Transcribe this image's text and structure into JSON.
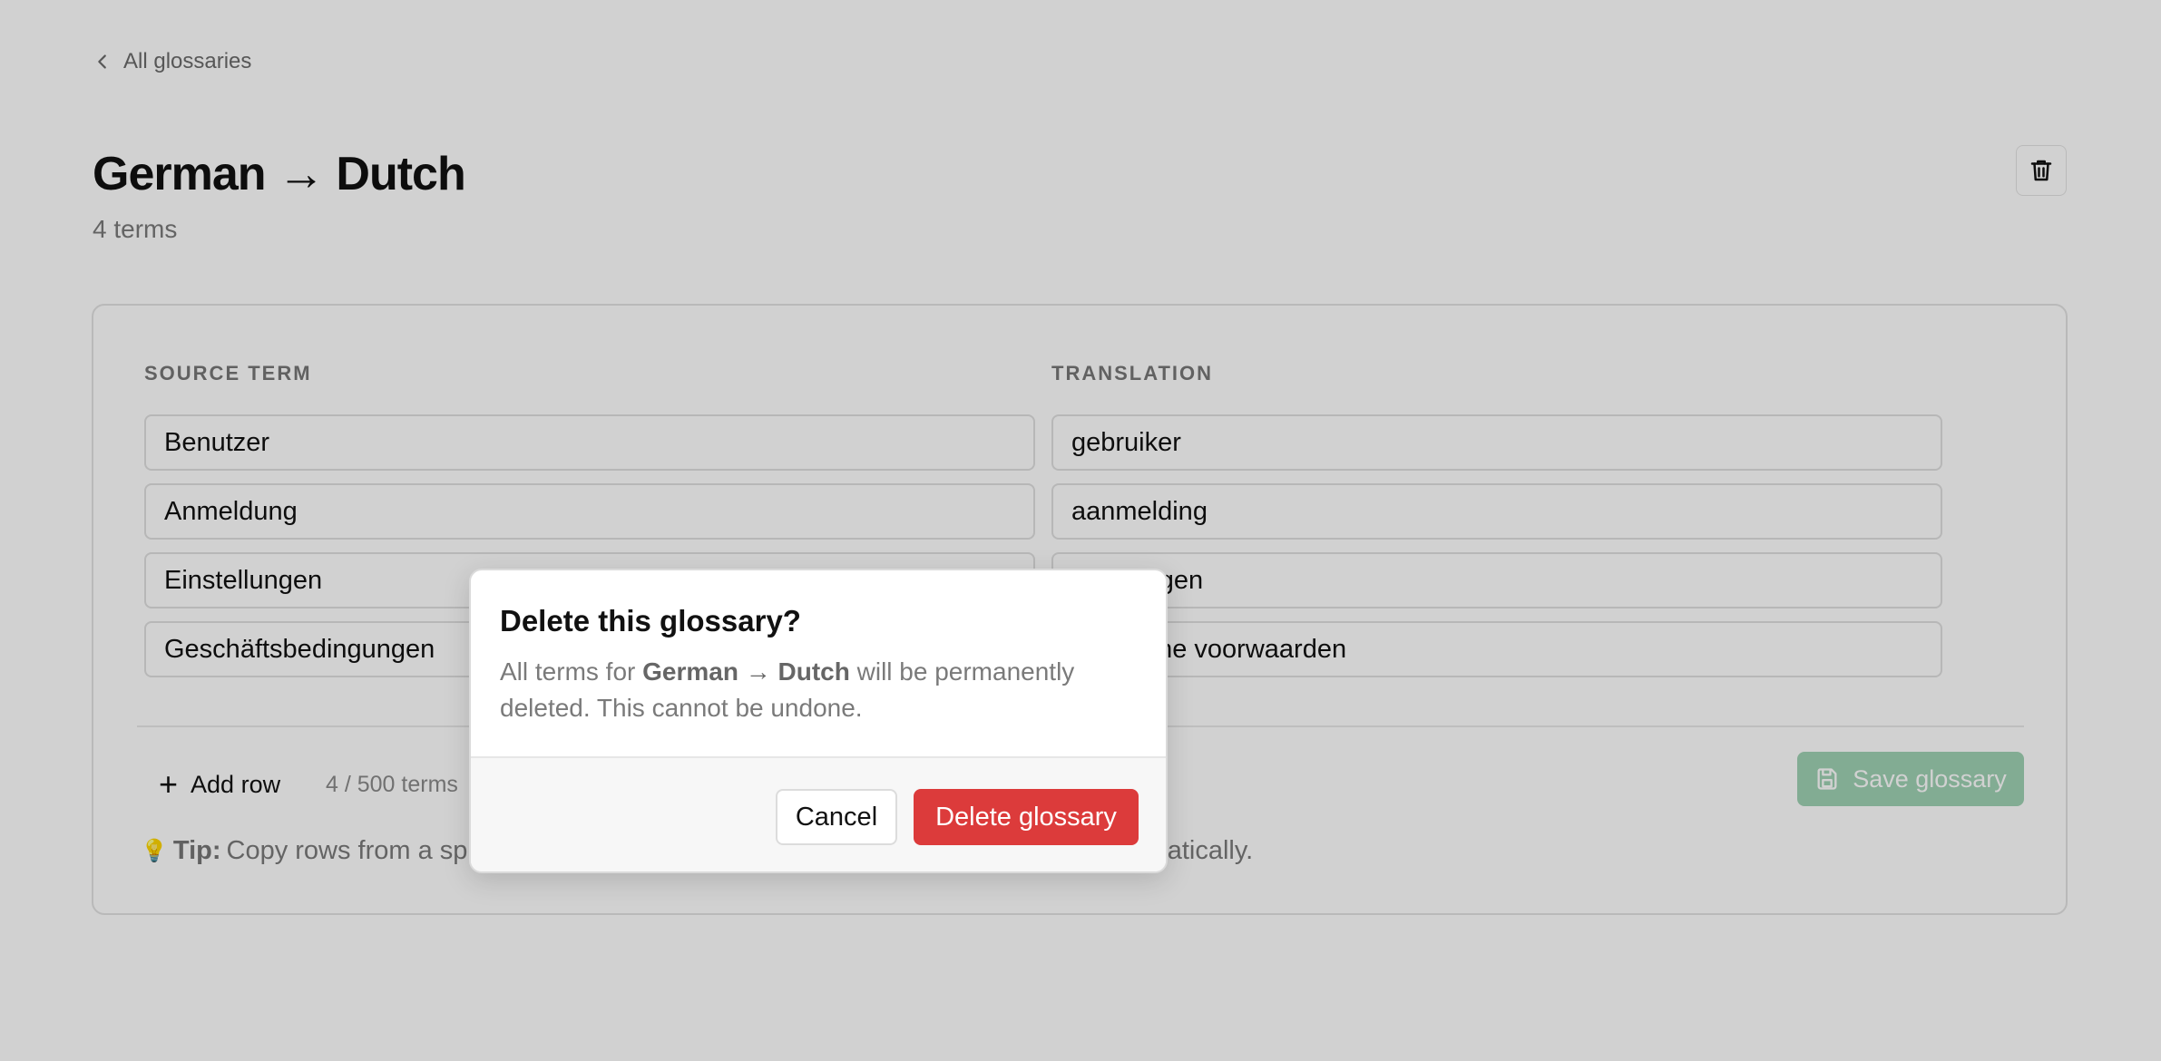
{
  "nav": {
    "back_label": "All glossaries",
    "back_icon": "chevron-left-icon"
  },
  "header": {
    "title": "German → Dutch",
    "subtitle": "4 terms",
    "delete_icon": "trash-icon"
  },
  "table": {
    "source_header": "SOURCE TERM",
    "translation_header": "TRANSLATION",
    "rows": [
      {
        "source": "Benutzer",
        "translation": "gebruiker"
      },
      {
        "source": "Anmeldung",
        "translation": "aanmelding"
      },
      {
        "source": "Einstellungen",
        "translation": "instellingen"
      },
      {
        "source": "Geschäftsbedingungen",
        "translation": "algemene voorwaarden"
      }
    ]
  },
  "footer": {
    "add_row_label": "Add row",
    "term_count": "4 / 500 terms",
    "save_label": "Save glossary",
    "save_icon": "floppy-disk-icon",
    "tip_label": "Tip:",
    "tip_text": "Copy rows from a spreadsheet and paste them here — they'll be imported automatically."
  },
  "dialog": {
    "title": "Delete this glossary?",
    "body_prefix": "All terms for ",
    "body_glossary": "German → Dutch",
    "body_suffix": " will be permanently deleted. This cannot be undone.",
    "cancel_label": "Cancel",
    "delete_label": "Delete glossary"
  },
  "colors": {
    "danger": "#dc3b3b",
    "save_disabled": "#9fd2b4",
    "overlay": "rgba(0,0,0,0.18)"
  }
}
